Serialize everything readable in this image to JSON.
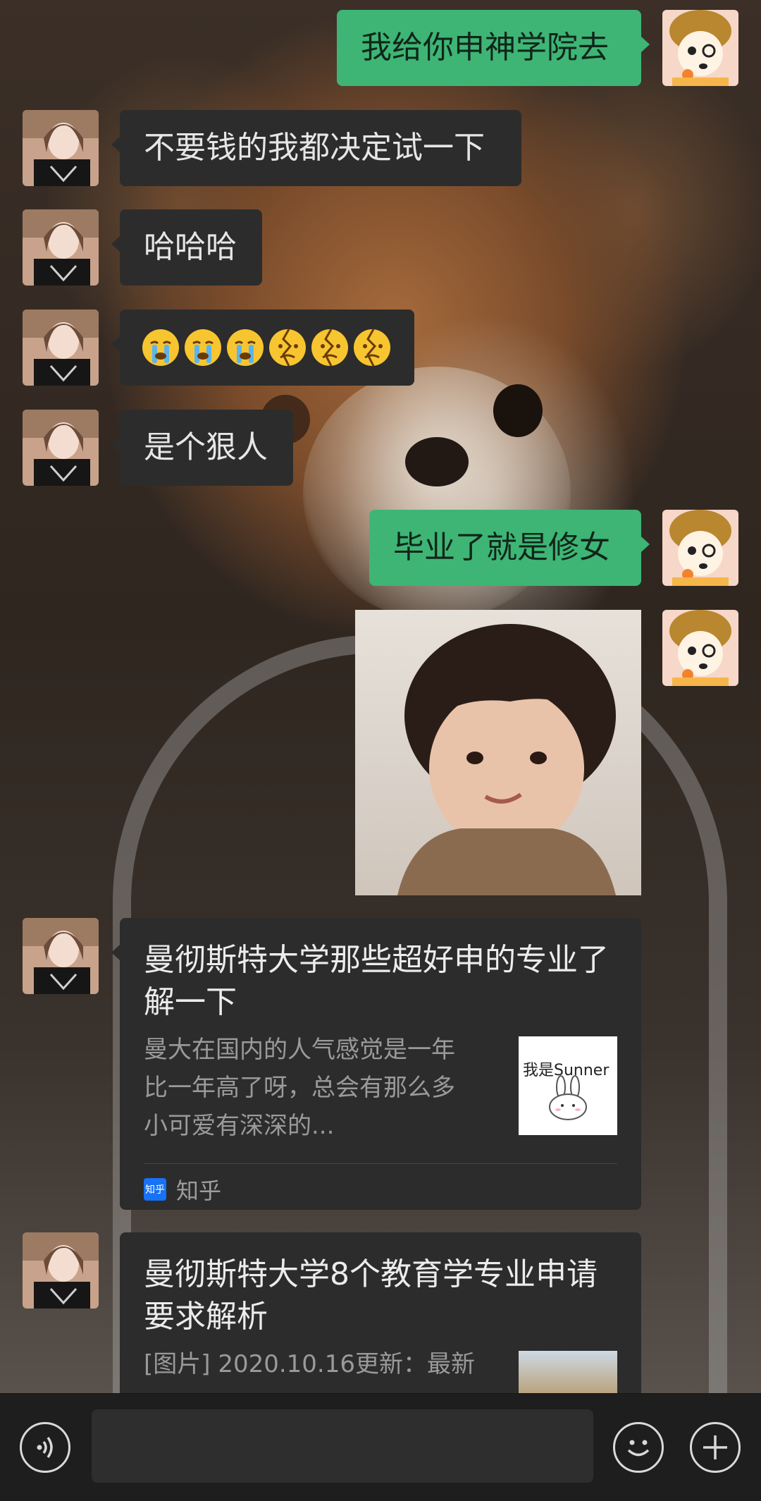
{
  "messages": [
    {
      "id": "m1",
      "side": "out",
      "text": "我给你申神学院去"
    },
    {
      "id": "m2",
      "side": "in",
      "text": "不要钱的我都决定试一下"
    },
    {
      "id": "m3",
      "side": "in",
      "text": "哈哈哈"
    },
    {
      "id": "m4",
      "side": "in",
      "emojis": [
        "crying-face-emoji",
        "crying-face-emoji",
        "crying-face-emoji",
        "broken-face-emoji",
        "broken-face-emoji",
        "broken-face-emoji"
      ]
    },
    {
      "id": "m5",
      "side": "in",
      "text": "是个狠人"
    },
    {
      "id": "m6",
      "side": "out",
      "text": "毕业了就是修女"
    },
    {
      "id": "m7",
      "side": "out",
      "image": "child-sticker-image"
    }
  ],
  "cards": [
    {
      "id": "c1",
      "title": "曼彻斯特大学那些超好申的专业了解一下",
      "desc_lines": [
        "曼大在国内的人气感觉是一年",
        "比一年高了呀，总会有那么多",
        "小可爱有深深的..."
      ],
      "thumb_text": "我是Sunner",
      "source": "知乎",
      "source_badge": "知乎"
    },
    {
      "id": "c2",
      "title": "曼彻斯特大学8个教育学专业申请要求解析",
      "desc_lines": [
        "[图片] 2020.10.16更新：最新"
      ]
    }
  ],
  "input": {
    "value": "",
    "placeholder": ""
  },
  "colors": {
    "out_bubble": "#3eb575",
    "in_bubble": "#2c2c2c",
    "bar": "#1e1e1e",
    "zhihu": "#1772f6"
  },
  "icons": {
    "voice": "voice-icon",
    "emoji": "emoji-icon",
    "plus": "plus-icon"
  }
}
